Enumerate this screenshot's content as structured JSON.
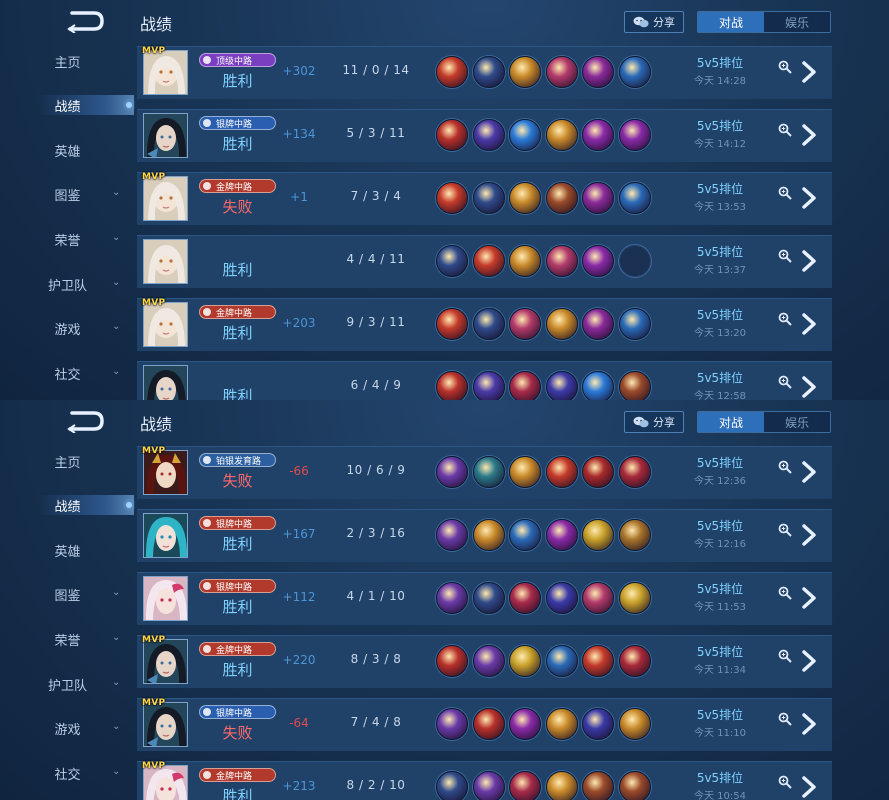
{
  "header": {
    "title": "战绩",
    "share_label": "分享",
    "tab_battle": "对战",
    "tab_fun": "娱乐"
  },
  "sidebar": {
    "items": [
      {
        "label": "主页",
        "chevron": false,
        "active": false
      },
      {
        "label": "战绩",
        "chevron": false,
        "active": true
      },
      {
        "label": "英雄",
        "chevron": false,
        "active": false
      },
      {
        "label": "图鉴",
        "chevron": true,
        "active": false
      },
      {
        "label": "荣誉",
        "chevron": true,
        "active": false
      },
      {
        "label": "护卫队",
        "chevron": true,
        "active": false
      },
      {
        "label": "游戏",
        "chevron": true,
        "active": false
      },
      {
        "label": "社交",
        "chevron": true,
        "active": false
      }
    ]
  },
  "colors": {
    "win": "#7fd2ff",
    "lose": "#ff6a6a",
    "accent": "#2d6fb8",
    "lane_gold": "#b23a2c",
    "lane_silver": "#2a5fb0",
    "lane_diamond": "#7a3fc0",
    "lane_plat": "#2c5fa0"
  },
  "screens": [
    {
      "matches": [
        {
          "mvp": "MVP",
          "lane": "顶级中路",
          "lane_color": "#7a3fc0",
          "result": "胜利",
          "win": true,
          "score": "+302",
          "kda": "11 / 0 / 14",
          "mode": "5v5排位",
          "time": "今天 14:28",
          "hero": "h-white",
          "items": [
            "#c43a2a",
            "#2e4a8a",
            "#c98a2a",
            "#b23a6a",
            "#8a2a9a",
            "#2a6ab8"
          ]
        },
        {
          "mvp": "",
          "lane": "银牌中路",
          "lane_color": "#2a5fb0",
          "result": "胜利",
          "win": true,
          "score": "+134",
          "kda": "5 / 3 / 11",
          "mode": "5v5排位",
          "time": "今天 14:12",
          "hero": "h-dark",
          "items": [
            "#b8302a",
            "#4a3aa8",
            "#2a7ad8",
            "#c98a2a",
            "#8a2aa8",
            "#8a2aa8"
          ]
        },
        {
          "mvp": "MVP",
          "lane": "金牌中路",
          "lane_color": "#b23a2c",
          "result": "失败",
          "win": false,
          "score": "+1",
          "kda": "7 / 3 / 4",
          "mode": "5v5排位",
          "time": "今天 13:53",
          "hero": "h-white",
          "items": [
            "#c43a2a",
            "#2e4a8a",
            "#c98a2a",
            "#9a4a2a",
            "#8a2a9a",
            "#2a6ab8"
          ]
        },
        {
          "mvp": "",
          "lane": "",
          "lane_color": "",
          "result": "胜利",
          "win": true,
          "score": "",
          "kda": "4 / 4 / 11",
          "mode": "5v5排位",
          "time": "今天 13:37",
          "hero": "h-white",
          "items": [
            "#2e4a8a",
            "#c43a2a",
            "#c98a2a",
            "#b23a6a",
            "#8a2aa8",
            ""
          ]
        },
        {
          "mvp": "MVP",
          "lane": "金牌中路",
          "lane_color": "#b23a2c",
          "result": "胜利",
          "win": true,
          "score": "+203",
          "kda": "9 / 3 / 11",
          "mode": "5v5排位",
          "time": "今天 13:20",
          "hero": "h-white",
          "items": [
            "#c43a2a",
            "#2e4a8a",
            "#b23a6a",
            "#c98a2a",
            "#8a2a9a",
            "#2a6ab8"
          ]
        },
        {
          "mvp": "",
          "lane": "",
          "lane_color": "",
          "result": "胜利",
          "win": true,
          "score": "",
          "kda": "6 / 4 / 9",
          "mode": "5v5排位",
          "time": "今天 12:58",
          "hero": "h-dark",
          "items": [
            "#b8302a",
            "#4a3aa8",
            "#a82a4a",
            "#3a3aa8",
            "#2a7ad8",
            "#9a4a2a"
          ]
        }
      ]
    },
    {
      "matches": [
        {
          "mvp": "MVP",
          "lane": "铂银发育路",
          "lane_color": "#2c5fa0",
          "result": "失败",
          "win": false,
          "score": "-66",
          "kda": "10 / 6 / 9",
          "mode": "5v5排位",
          "time": "今天 12:36",
          "hero": "h-red",
          "items": [
            "#6a3aa8",
            "#2a7a8a",
            "#c98a2a",
            "#c43a2a",
            "#a82a2a",
            "#a82a3a"
          ]
        },
        {
          "mvp": "",
          "lane": "银牌中路",
          "lane_color": "#b23a2c",
          "result": "胜利",
          "win": true,
          "score": "+167",
          "kda": "2 / 3 / 16",
          "mode": "5v5排位",
          "time": "今天 12:16",
          "hero": "h-cyan",
          "items": [
            "#6a3aa8",
            "#c98a2a",
            "#2a6ab8",
            "#8a2aa8",
            "#c9a22a",
            "#a8742a"
          ]
        },
        {
          "mvp": "",
          "lane": "银牌中路",
          "lane_color": "#b23a2c",
          "result": "胜利",
          "win": true,
          "score": "+112",
          "kda": "4 / 1 / 10",
          "mode": "5v5排位",
          "time": "今天 11:53",
          "hero": "h-pink",
          "items": [
            "#6a3aa8",
            "#2e4a8a",
            "#a82a4a",
            "#3a3aa8",
            "#b23a6a",
            "#c9a22a"
          ]
        },
        {
          "mvp": "MVP",
          "lane": "金牌中路",
          "lane_color": "#b23a2c",
          "result": "胜利",
          "win": true,
          "score": "+220",
          "kda": "8 / 3 / 8",
          "mode": "5v5排位",
          "time": "今天 11:34",
          "hero": "h-dark",
          "items": [
            "#b8302a",
            "#6a3aa8",
            "#c9a22a",
            "#2a6ab8",
            "#c43a2a",
            "#a82a3a"
          ]
        },
        {
          "mvp": "MVP",
          "lane": "银牌中路",
          "lane_color": "#2a5fb0",
          "result": "失败",
          "win": false,
          "score": "-64",
          "kda": "7 / 4 / 8",
          "mode": "5v5排位",
          "time": "今天 11:10",
          "hero": "h-dark",
          "items": [
            "#6a3aa8",
            "#b8302a",
            "#8a2aa8",
            "#c98a2a",
            "#3a3aa8",
            "#c98a2a"
          ]
        },
        {
          "mvp": "MVP",
          "lane": "金牌中路",
          "lane_color": "#b23a2c",
          "result": "胜利",
          "win": true,
          "score": "+213",
          "kda": "8 / 2 / 10",
          "mode": "5v5排位",
          "time": "今天 10:54",
          "hero": "h-pink",
          "items": [
            "#2e4a8a",
            "#6a3aa8",
            "#a82a4a",
            "#c98a2a",
            "#9a4a2a",
            "#9a4a2a"
          ]
        }
      ]
    }
  ]
}
